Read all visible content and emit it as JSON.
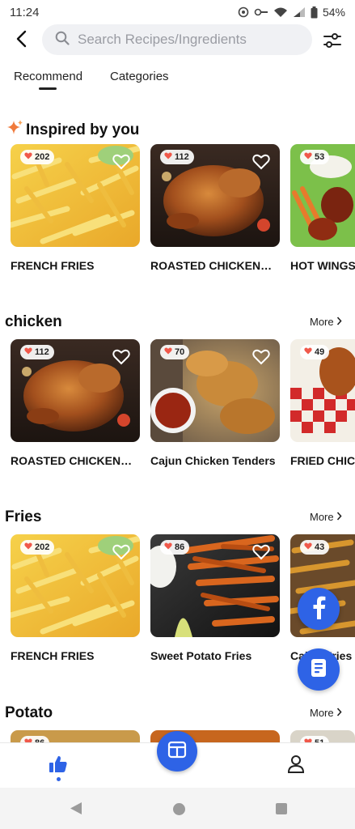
{
  "status_bar": {
    "time": "11:24",
    "battery": "54%"
  },
  "search": {
    "placeholder": "Search Recipes/Ingredients"
  },
  "tabs": [
    {
      "label": "Recommend",
      "active": true
    },
    {
      "label": "Categories",
      "active": false
    }
  ],
  "sections": [
    {
      "title": "Inspired by you",
      "more": null,
      "cards": [
        {
          "name": "FRENCH FRIES",
          "likes": "202"
        },
        {
          "name": "ROASTED CHICKEN…",
          "likes": "112"
        },
        {
          "name": "HOT WINGS",
          "likes": "53"
        }
      ]
    },
    {
      "title": "chicken",
      "more": "More",
      "cards": [
        {
          "name": "ROASTED CHICKEN…",
          "likes": "112"
        },
        {
          "name": "Cajun Chicken Tenders",
          "likes": "70"
        },
        {
          "name": "FRIED CHICKEN",
          "likes": "49"
        }
      ]
    },
    {
      "title": "Fries",
      "more": "More",
      "cards": [
        {
          "name": "FRENCH FRIES",
          "likes": "202"
        },
        {
          "name": "Sweet Potato Fries",
          "likes": "86"
        },
        {
          "name": "Cajun Fries",
          "likes": "43"
        }
      ]
    },
    {
      "title": "Potato",
      "more": "More",
      "cards": [
        {
          "name": "",
          "likes": "86"
        },
        {
          "name": "",
          "likes": ""
        },
        {
          "name": "",
          "likes": "51"
        }
      ]
    }
  ],
  "colors": {
    "accent": "#2e63e6",
    "heart": "#f0584a",
    "facebook": "#2e63e6"
  },
  "icons": {
    "back": "arrow-left-icon",
    "search": "search-icon",
    "filter": "sliders-icon",
    "sparkle": "sparkle-icon",
    "heart": "heart-icon",
    "facebook": "facebook-icon",
    "notes": "notes-icon",
    "home": "thumbs-up-icon",
    "center": "meal-plan-icon",
    "profile": "person-icon"
  }
}
